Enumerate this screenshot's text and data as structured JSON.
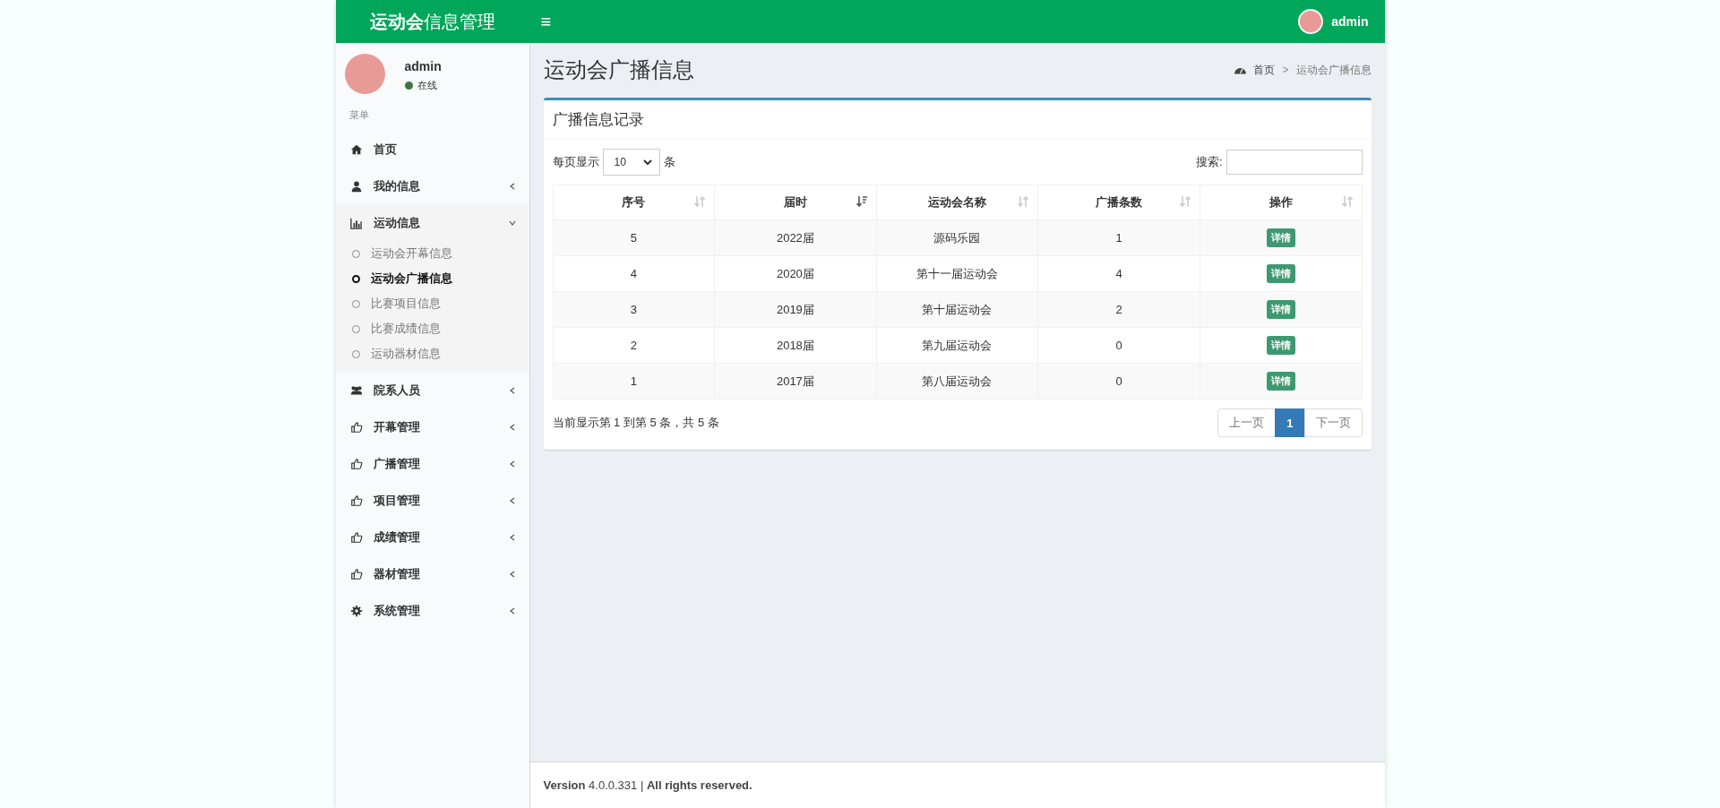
{
  "header": {
    "logo": "**运动会**信息管理",
    "menu_toggle": "≡",
    "user": "admin"
  },
  "sidebar": {
    "user": {
      "name": "admin",
      "status": "在线"
    },
    "menu_label": "菜单",
    "items": [
      {
        "kind": "link",
        "label": "首页"
      },
      {
        "kind": "menu",
        "label": "我的信息",
        "expanded": false
      },
      {
        "kind": "menu",
        "label": "运动信息",
        "expanded": true,
        "children": [
          {
            "label": "运动会开幕信息",
            "selected": false
          },
          {
            "label": "运动会广播信息",
            "selected": true
          },
          {
            "label": "比赛项目信息",
            "selected": false
          },
          {
            "label": "比赛成绩信息",
            "selected": false
          },
          {
            "label": "运动器材信息",
            "selected": false
          }
        ]
      },
      {
        "kind": "menu",
        "label": "院系人员",
        "expanded": false
      },
      {
        "kind": "menu",
        "label": "开幕管理",
        "expanded": false
      },
      {
        "kind": "menu",
        "label": "广播管理",
        "expanded": false
      },
      {
        "kind": "menu",
        "label": "项目管理",
        "expanded": false
      },
      {
        "kind": "menu",
        "label": "成绩管理",
        "expanded": false
      },
      {
        "kind": "menu",
        "label": "器材管理",
        "expanded": false
      },
      {
        "kind": "menu",
        "label": "系统管理",
        "expanded": false
      }
    ]
  },
  "page": {
    "title": "运动会广播信息",
    "breadcrumb": [
      "首页",
      "运动会广播信息"
    ],
    "breadcrumb_separator": ">"
  },
  "box": {
    "title": "广播信息记录",
    "length_label": "每页显示",
    "length_value": "10",
    "length_unit": "条",
    "search_label": "搜索:",
    "table": {
      "columns": [
        {
          "label": "序号",
          "sorted": false
        },
        {
          "label": "届时",
          "sorted": true
        },
        {
          "label": "运动会名称",
          "sorted": false
        },
        {
          "label": "广播条数",
          "sorted": false
        },
        {
          "label": "操作",
          "sorted": false
        }
      ],
      "rows": [
        {
          "cells": [
            "5",
            "2022届",
            "源码乐园",
            "1"
          ],
          "action": "详情"
        },
        {
          "cells": [
            "4",
            "2020届",
            "第十一届运动会",
            "4"
          ],
          "action": "详情"
        },
        {
          "cells": [
            "3",
            "2019届",
            "第十届运动会",
            "2"
          ],
          "action": "详情"
        },
        {
          "cells": [
            "2",
            "2018届",
            "第九届运动会",
            "0"
          ],
          "action": "详情"
        },
        {
          "cells": [
            "1",
            "2017届",
            "第八届运动会",
            "0"
          ],
          "action": "详情"
        }
      ]
    },
    "info": "当前显示第 1 到第 5 条，共 5 条",
    "pagination": [
      {
        "label": "上一页",
        "selected": false
      },
      {
        "label": "1",
        "selected": true
      },
      {
        "label": "下一页",
        "selected": false
      }
    ]
  },
  "footer": "**Version** 4.0.0.331 | **All rights reserved.**"
}
